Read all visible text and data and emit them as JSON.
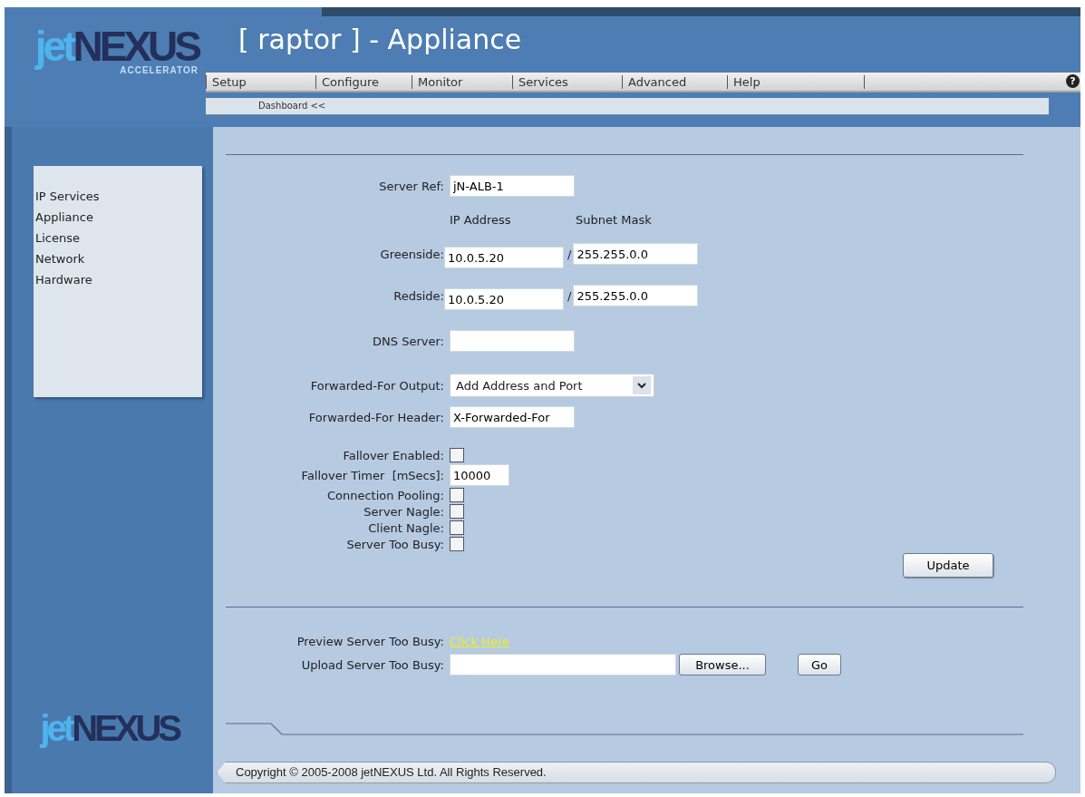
{
  "header": {
    "logo": {
      "prefix": "jet",
      "name": "NEXUS",
      "tagline": "ACCELERATOR"
    },
    "title": "[ raptor ] - Appliance",
    "menu": [
      {
        "label": "Setup",
        "selected": false
      },
      {
        "label": "Configure",
        "selected": false
      },
      {
        "label": "Monitor",
        "selected": false
      },
      {
        "label": "Services",
        "selected": false
      },
      {
        "label": "Advanced",
        "selected": false
      },
      {
        "label": "Help",
        "selected": false
      }
    ],
    "help": "?",
    "breadcrumb": "Dashboard <<"
  },
  "sidebar": {
    "items": [
      {
        "label": "IP Services"
      },
      {
        "label": "Appliance"
      },
      {
        "label": "License"
      },
      {
        "label": "Network"
      },
      {
        "label": "Hardware"
      }
    ],
    "logo": {
      "prefix": "jet",
      "name": "NEXUS"
    }
  },
  "form": {
    "fields": [
      {
        "kind": "text",
        "label": "Server Ref:",
        "value": "jN-ALB-1"
      },
      {
        "kind": "heading",
        "columns": [
          "IP Address",
          "Subnet Mask"
        ]
      },
      {
        "kind": "ip_pair",
        "label": "Greenside:",
        "value": "10.0.5.20",
        "separator": "/",
        "mask": "255.255.0.0"
      },
      {
        "kind": "ip_pair",
        "label": "Redside:",
        "value": "10.0.5.20",
        "separator": "/",
        "mask": "255.255.0.0"
      },
      {
        "kind": "text",
        "label": "DNS Server:"
      },
      {
        "kind": "select",
        "label": "Forwarded-For Output:",
        "value": "Add Address and Port"
      },
      {
        "kind": "text",
        "label": "Forwarded-For Header:",
        "value": "X-Forwarded-For"
      },
      {
        "kind": "checkbox",
        "label": "Fallover Enabled:",
        "checked": false
      },
      {
        "kind": "short",
        "label": "Fallover Timer  [mSecs]:",
        "value": "10000"
      },
      {
        "kind": "checkbox",
        "label": "Connection Pooling:",
        "checked": false
      },
      {
        "kind": "checkbox",
        "label": "Server Nagle:",
        "checked": false
      },
      {
        "kind": "checkbox",
        "label": "Client Nagle:",
        "checked": false
      },
      {
        "kind": "checkbox",
        "label": "Server Too Busy:",
        "checked": false
      }
    ],
    "button": "Update"
  },
  "upload": {
    "preview_label": "Preview Server Too Busy:",
    "preview_link": "Click Here",
    "upload_label": "Upload Server Too Busy:",
    "browse": "Browse...",
    "go": "Go"
  },
  "footer": {
    "copyright": "Copyright © 2005-2008 jetNEXUS Ltd. All Rights Reserved."
  }
}
